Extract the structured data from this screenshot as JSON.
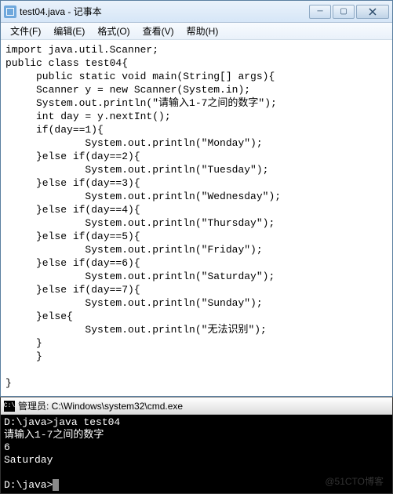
{
  "notepad": {
    "title": "test04.java - 记事本",
    "menus": {
      "file": "文件(F)",
      "edit": "编辑(E)",
      "format": "格式(O)",
      "view": "查看(V)",
      "help": "帮助(H)"
    },
    "content": "import java.util.Scanner;\npublic class test04{\n     public static void main(String[] args){\n     Scanner y = new Scanner(System.in);\n     System.out.println(\"请输入1-7之间的数字\");\n     int day = y.nextInt();\n     if(day==1){\n             System.out.println(\"Monday\");\n     }else if(day==2){\n             System.out.println(\"Tuesday\");\n     }else if(day==3){\n             System.out.println(\"Wednesday\");\n     }else if(day==4){\n             System.out.println(\"Thursday\");\n     }else if(day==5){\n             System.out.println(\"Friday\");\n     }else if(day==6){\n             System.out.println(\"Saturday\");\n     }else if(day==7){\n             System.out.println(\"Sunday\");\n     }else{\n             System.out.println(\"无法识别\");\n     }\n     }\n\n}"
  },
  "cmd": {
    "title": "管理员: C:\\Windows\\system32\\cmd.exe",
    "output": "D:\\java>java test04\n请输入1-7之间的数字\n6\nSaturday\n\nD:\\java>"
  },
  "watermark": "@51CTO博客"
}
